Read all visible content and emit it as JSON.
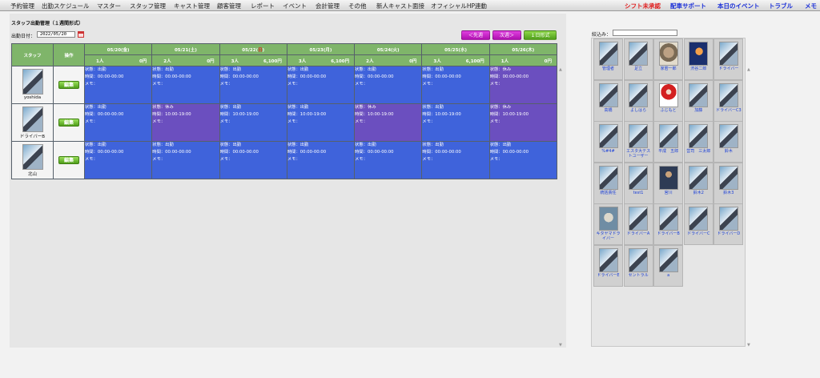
{
  "nav": {
    "left": [
      "予約管理",
      "出勤スケジュール",
      "マスター",
      "スタッフ管理",
      "キャスト管理",
      "顧客管理",
      "レポート",
      "イベント",
      "会計管理",
      "その他",
      "新人キャスト面接",
      "オフィシャルHP連動"
    ],
    "right": [
      "シフト未承認",
      "配車サポート",
      "本日のイベント",
      "トラブル",
      "メモ"
    ],
    "right_colors": [
      "#e02020",
      "#1a2fd8",
      "#1a2fd8",
      "#1a2fd8",
      "#1a2fd8"
    ]
  },
  "page": {
    "title": "スタッフ出勤管理（１週間形式）",
    "date_label": "出勤日付：",
    "date_value": "2022/05/20",
    "prev_button": "＜先週",
    "next_button": "次週＞",
    "day_button": "１日形式"
  },
  "table": {
    "col_staff": "スタッフ",
    "col_ops": "操作",
    "days": [
      {
        "date": "05/20(金)",
        "people": "1人",
        "amount": "0円"
      },
      {
        "date": "05/21(土)",
        "people": "2人",
        "amount": "0円"
      },
      {
        "date_prefix": "05/22(",
        "date_holiday": "日",
        "date_suffix": ")",
        "people": "3人",
        "amount": "6,100円"
      },
      {
        "date": "05/23(月)",
        "people": "3人",
        "amount": "6,100円"
      },
      {
        "date": "05/24(火)",
        "people": "2人",
        "amount": "0円"
      },
      {
        "date": "05/25(水)",
        "people": "3人",
        "amount": "6,100円"
      },
      {
        "date": "05/26(木)",
        "people": "1人",
        "amount": "0円"
      }
    ],
    "edit_label": "編集",
    "rows": [
      {
        "name": "yoshida",
        "cells": [
          {
            "status": "状態：出勤",
            "time": "時間：00:00-00:00",
            "memo": "メモ："
          },
          {
            "status": "状態：出勤",
            "time": "時間：00:00-00:00",
            "memo": "メモ："
          },
          {
            "status": "状態：出勤",
            "time": "時間：00:00-00:00",
            "memo": "メモ："
          },
          {
            "status": "状態：出勤",
            "time": "時間：00:00-00:00",
            "memo": "メモ："
          },
          {
            "status": "状態：出勤",
            "time": "時間：00:00-00:00",
            "memo": "メモ："
          },
          {
            "status": "状態：出勤",
            "time": "時間：00:00-00:00",
            "memo": "メモ："
          },
          {
            "status": "状態：休み",
            "time": "時間：00:00-00:00",
            "memo": "メモ："
          }
        ],
        "colors": [
          "blue",
          "blue",
          "blue",
          "blue",
          "blue",
          "blue",
          "purple"
        ]
      },
      {
        "name": "ドライバーB",
        "cells": [
          {
            "status": "状態：出勤",
            "time": "時間：00:00-00:00",
            "memo": "メモ："
          },
          {
            "status": "状態：休み",
            "time": "時間：10:00-19:00",
            "memo": "メモ："
          },
          {
            "status": "状態：出勤",
            "time": "時間：10:00-19:00",
            "memo": "メモ："
          },
          {
            "status": "状態：出勤",
            "time": "時間：10:00-19:00",
            "memo": "メモ："
          },
          {
            "status": "状態：休み",
            "time": "時間：10:00-19:00",
            "memo": "メモ："
          },
          {
            "status": "状態：出勤",
            "time": "時間：10:00-19:00",
            "memo": "メモ："
          },
          {
            "status": "状態：休み",
            "time": "時間：10:00-19:00",
            "memo": "メモ："
          }
        ],
        "colors": [
          "blue",
          "purple",
          "blue",
          "blue",
          "purple",
          "blue",
          "purple"
        ]
      },
      {
        "name": "北山",
        "cells": [
          {
            "status": "状態：出勤",
            "time": "時間：00:00-00:00",
            "memo": "メモ："
          },
          {
            "status": "状態：出勤",
            "time": "時間：00:00-00:00",
            "memo": "メモ："
          },
          {
            "status": "状態：出勤",
            "time": "時間：00:00-00:00",
            "memo": "メモ："
          },
          {
            "status": "状態：出勤",
            "time": "時間：00:00-00:00",
            "memo": "メモ："
          },
          {
            "status": "状態：出勤",
            "time": "時間：00:00-00:00",
            "memo": "メモ："
          },
          {
            "status": "状態：出勤",
            "time": "時間：00:00-00:00",
            "memo": "メモ："
          },
          {
            "status": "状態：出勤",
            "time": "時間：00:00-00:00",
            "memo": "メモ："
          }
        ],
        "colors": [
          "blue",
          "blue",
          "blue",
          "blue",
          "blue",
          "blue",
          "blue"
        ]
      }
    ]
  },
  "sidebar": {
    "filter_label": "絞込み：",
    "staff": [
      {
        "name": "管理者",
        "photo": "default"
      },
      {
        "name": "足立",
        "photo": "default"
      },
      {
        "name": "家若一郎",
        "photo": "koala"
      },
      {
        "name": "渋谷二郎",
        "photo": "jelly"
      },
      {
        "name": "ドライバー",
        "photo": "default"
      },
      {
        "name": "高橋",
        "photo": "default"
      },
      {
        "name": "よしはら",
        "photo": "default"
      },
      {
        "name": "ふじもと",
        "photo": "santa"
      },
      {
        "name": "加藤",
        "photo": "default"
      },
      {
        "name": "ドライバーC3",
        "photo": "default"
      },
      {
        "name": "%#4#",
        "photo": "default"
      },
      {
        "name": "エスタ大テストユーザー",
        "photo": "default"
      },
      {
        "name": "平成　五郎",
        "photo": "default"
      },
      {
        "name": "営司　三太郎",
        "photo": "default"
      },
      {
        "name": "鈴木",
        "photo": "default"
      },
      {
        "name": "統括責任",
        "photo": "default"
      },
      {
        "name": "test1",
        "photo": "default"
      },
      {
        "name": "宮川",
        "photo": "person"
      },
      {
        "name": "鈴木2",
        "photo": "default"
      },
      {
        "name": "鈴木3",
        "photo": "default"
      },
      {
        "name": "キタヤマドライバー",
        "photo": "bear"
      },
      {
        "name": "ドライバーA",
        "photo": "default"
      },
      {
        "name": "ドライバーB",
        "photo": "default"
      },
      {
        "name": "ドライバーC",
        "photo": "default"
      },
      {
        "name": "ドライバーD",
        "photo": "default"
      },
      {
        "name": "ドライバーE",
        "photo": "default"
      },
      {
        "name": "セントラル",
        "photo": "default"
      },
      {
        "name": "a",
        "photo": "default"
      }
    ]
  }
}
